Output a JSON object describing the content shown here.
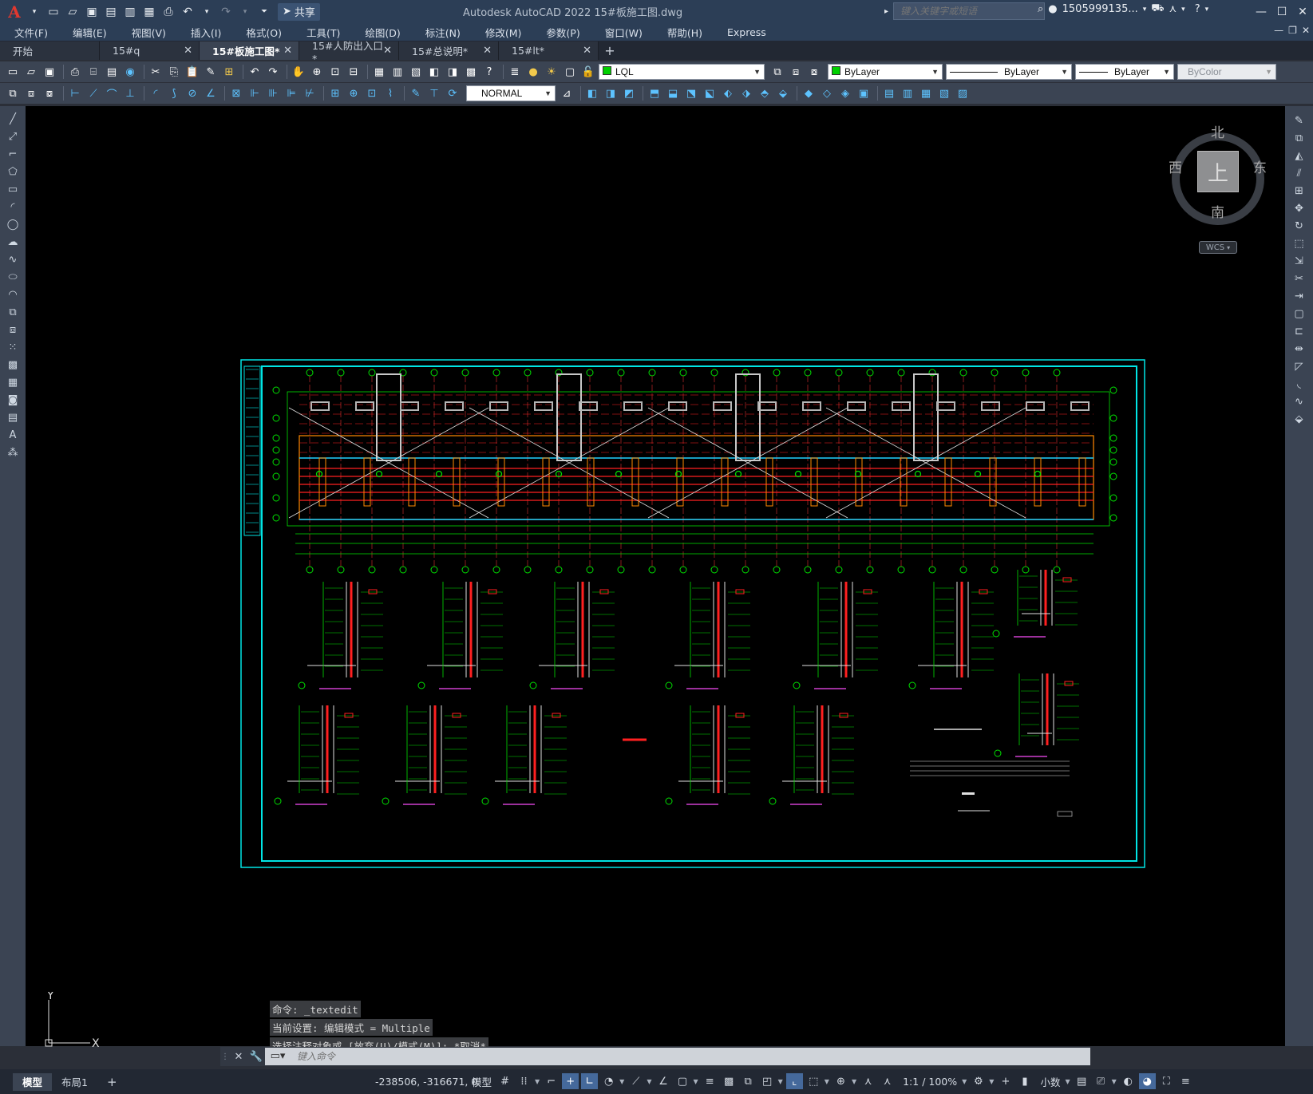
{
  "titlebar": {
    "app_title": "Autodesk AutoCAD 2022    15#板施工图.dwg",
    "share_label": "共享",
    "search_placeholder": "键入关键字或短语",
    "user_name": "1505999135..."
  },
  "menu": {
    "items": [
      "文件(F)",
      "编辑(E)",
      "视图(V)",
      "插入(I)",
      "格式(O)",
      "工具(T)",
      "绘图(D)",
      "标注(N)",
      "修改(M)",
      "参数(P)",
      "窗口(W)",
      "帮助(H)",
      "Express"
    ]
  },
  "tabs": [
    {
      "label": "开始",
      "active": false,
      "closable": false
    },
    {
      "label": "15#q",
      "active": false,
      "closable": true
    },
    {
      "label": "15#板施工图*",
      "active": true,
      "closable": true
    },
    {
      "label": "15#人防出入口*",
      "active": false,
      "closable": true
    },
    {
      "label": "15#总说明*",
      "active": false,
      "closable": true
    },
    {
      "label": "15#lt*",
      "active": false,
      "closable": true
    }
  ],
  "properties": {
    "layer_name": "LQL",
    "layer_color": "#00d000",
    "color_value": "ByLayer",
    "linetype_value": "ByLayer",
    "lineweight_value": "ByLayer",
    "plotstyle_value": "ByColor",
    "text_style": "NORMAL"
  },
  "viewcube": {
    "north": "北",
    "south": "南",
    "east": "东",
    "west": "西",
    "top_face": "上",
    "wcs_label": "WCS"
  },
  "ucs": {
    "x_label": "X",
    "y_label": "Y"
  },
  "command": {
    "history": [
      "命令: _textedit",
      "当前设置: 编辑模式 = Multiple",
      "选择注释对象或 [放弃(U)/模式(M)]: *取消*"
    ],
    "placeholder": "键入命令"
  },
  "status": {
    "model_tab": "模型",
    "layout_tab": "布局1",
    "coords": "-238506, -316671, 0",
    "space_label": "模型",
    "scale": "1:1 / 100%",
    "units": "小数"
  },
  "colors": {
    "title_bg": "#2c3e56",
    "toolbar_bg": "#3b4453",
    "canvas_bg": "#000000",
    "border_cyan": "#00e5e5"
  }
}
